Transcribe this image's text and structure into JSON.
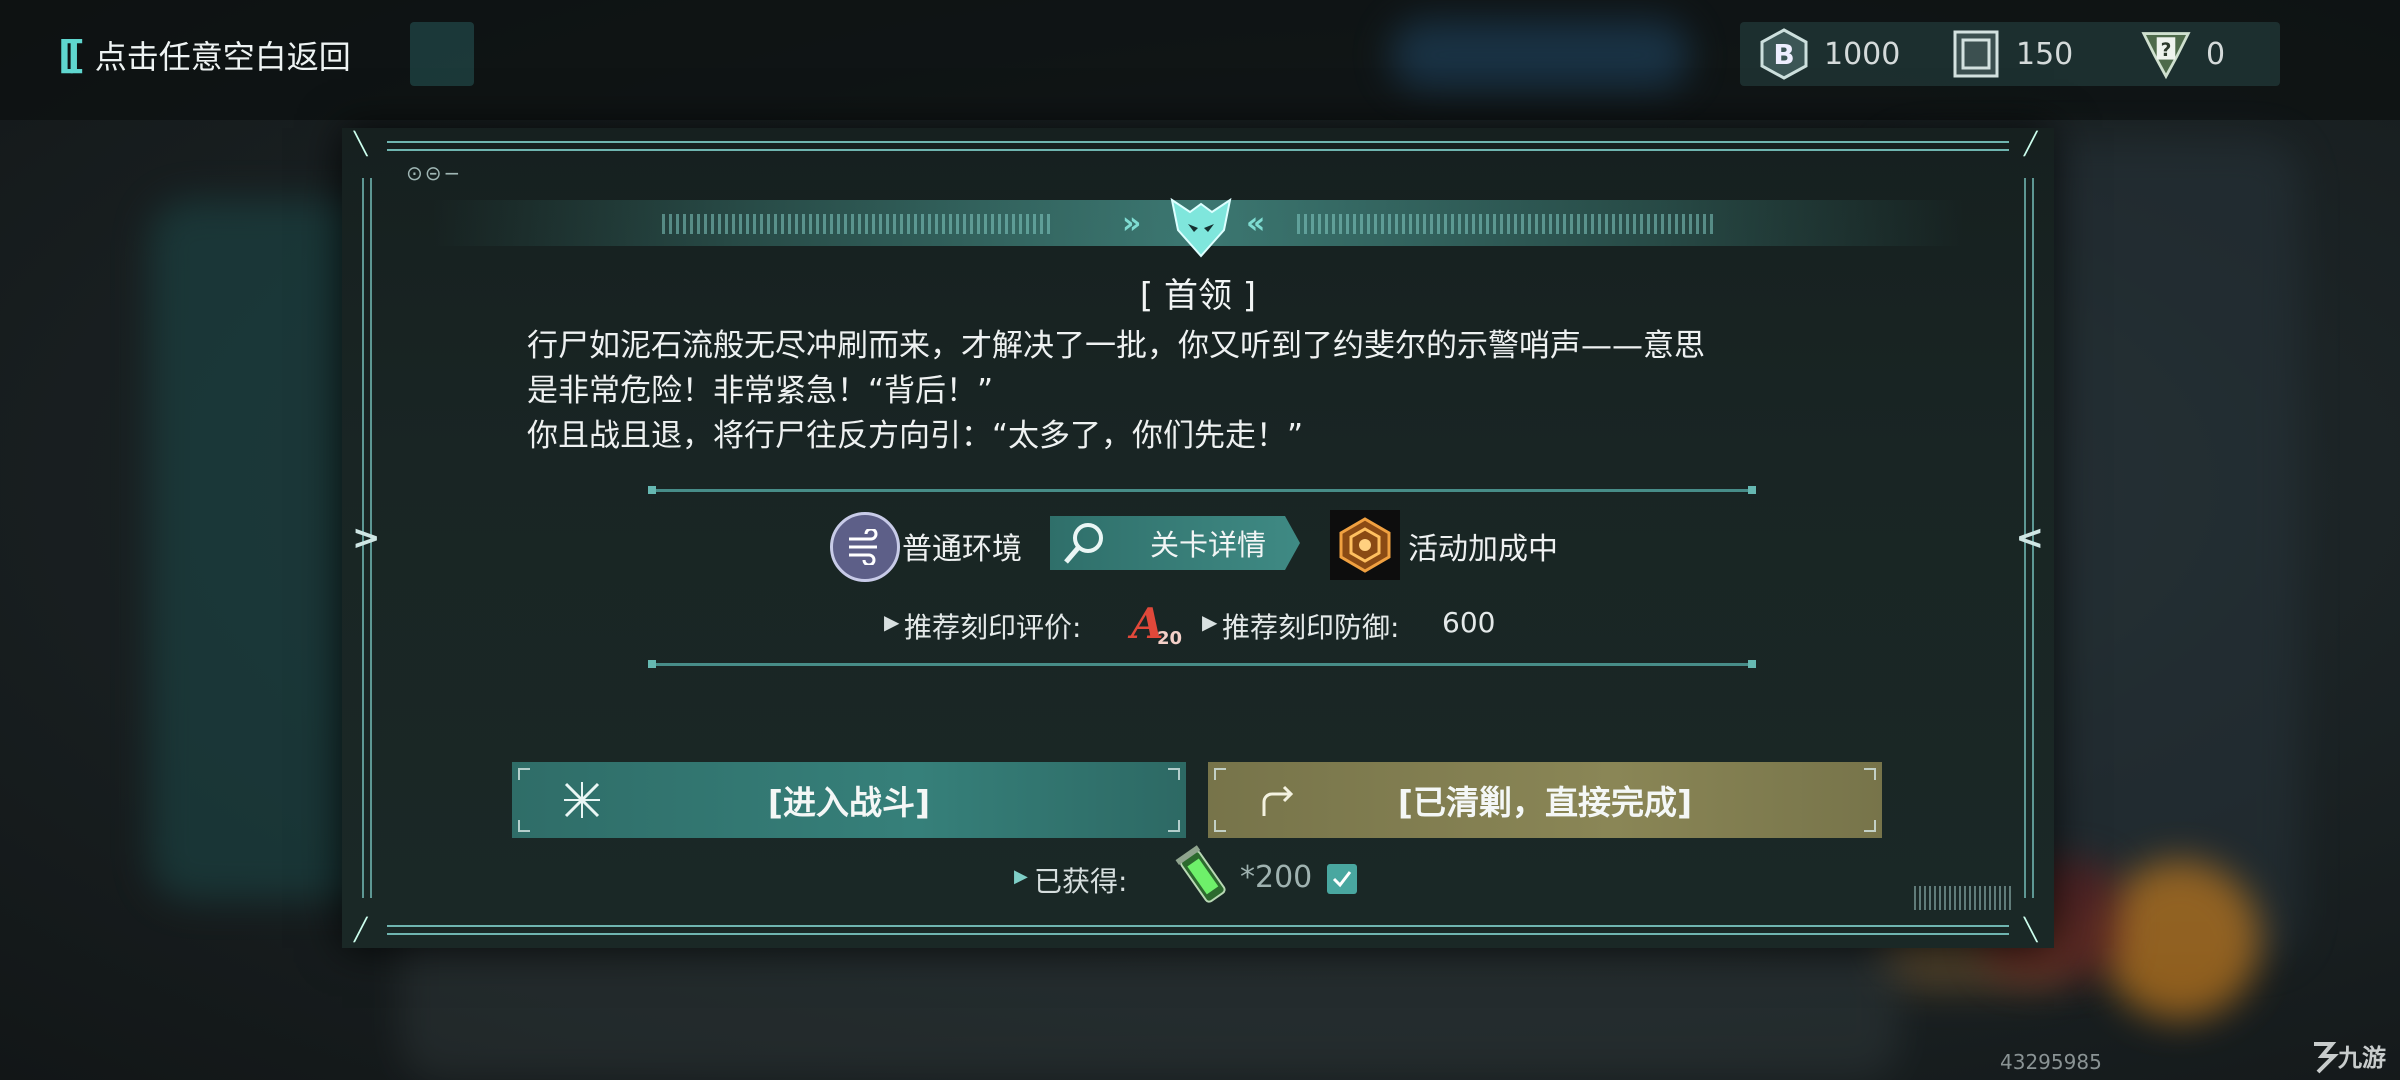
{
  "header": {
    "back_label": "点击任意空白返回"
  },
  "currencies": [
    {
      "icon": "coin-icon",
      "value": "1000"
    },
    {
      "icon": "chip-icon",
      "value": "150"
    },
    {
      "icon": "card-icon",
      "value": "0"
    }
  ],
  "dialog": {
    "title": "[ 首领 ]",
    "description": [
      "行尸如泥石流般无尽冲刷而来，才解决了一批，你又听到了约斐尔的示警哨声——意思",
      "是非常危险！非常紧急！“背后！”",
      "你且战且退，将行尸往反方向引：“太多了，你们先走！”"
    ],
    "environment_label": "普通环境",
    "detail_button": "关卡详情",
    "event_label": "活动加成中",
    "recommend_rating_label": "推荐刻印评价:",
    "recommend_rating_badge": "A20",
    "recommend_defense_label": "推荐刻印防御:",
    "recommend_defense_value": "600",
    "battle_button": "[进入战斗]",
    "clear_button": "[已清剿，直接完成]",
    "reward_label": "已获得:",
    "reward_count": "*200"
  },
  "footer": {
    "uid": "43295985",
    "watermark": "九游"
  },
  "colors": {
    "accent_teal": "#36807a",
    "accent_olive": "#8a8656",
    "panel_bg": "#192524"
  }
}
